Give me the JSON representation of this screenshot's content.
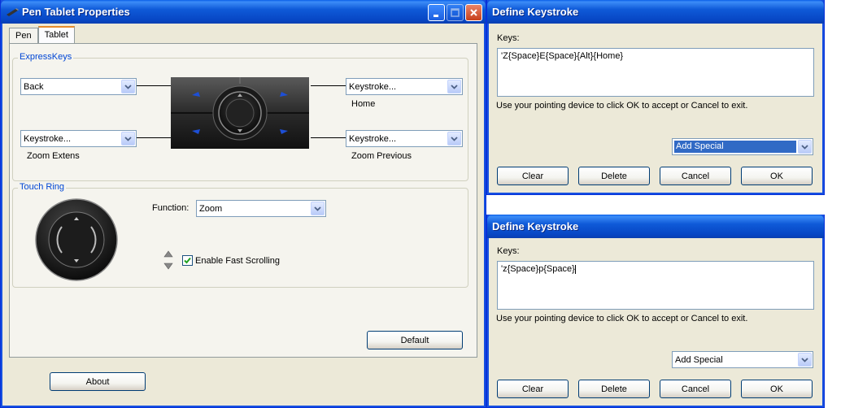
{
  "pen_tablet": {
    "title": "Pen Tablet Properties",
    "tabs": [
      {
        "label": "Pen"
      },
      {
        "label": "Tablet"
      }
    ],
    "expresskeys": {
      "group_label": "ExpressKeys",
      "top_left": {
        "value": "Back",
        "caption": ""
      },
      "bottom_left": {
        "value": "Keystroke...",
        "caption": "Zoom Extens"
      },
      "top_right": {
        "value": "Keystroke...",
        "caption": "Home"
      },
      "bottom_right": {
        "value": "Keystroke...",
        "caption": "Zoom Previous"
      }
    },
    "touch_ring": {
      "group_label": "Touch Ring",
      "function_label": "Function:",
      "function_value": "Zoom",
      "fast_scrolling_label": "Enable Fast Scrolling",
      "fast_scrolling_checked": true
    },
    "default_label": "Default",
    "about_label": "About"
  },
  "define_keystroke_dialogs": [
    {
      "title": "Define Keystroke",
      "keys_label": "Keys:",
      "keys_value": "'Z{Space}E{Space}{Alt}{Home}",
      "hint": "Use your pointing device to click OK to accept or Cancel to exit.",
      "add_special": "Add Special",
      "add_special_highlighted": true,
      "buttons": {
        "clear": "Clear",
        "delete": "Delete",
        "cancel": "Cancel",
        "ok": "OK"
      }
    },
    {
      "title": "Define Keystroke",
      "keys_label": "Keys:",
      "keys_value": "'z{Space}p{Space}",
      "hint": "Use your pointing device to click OK to accept or Cancel to exit.",
      "add_special": "Add Special",
      "add_special_highlighted": false,
      "buttons": {
        "clear": "Clear",
        "delete": "Delete",
        "cancel": "Cancel",
        "ok": "OK"
      }
    }
  ],
  "colors": {
    "titlebar": "#0746c4",
    "window_face": "#ece9d8",
    "group_label": "#0046d5",
    "selection": "#316ac5"
  }
}
